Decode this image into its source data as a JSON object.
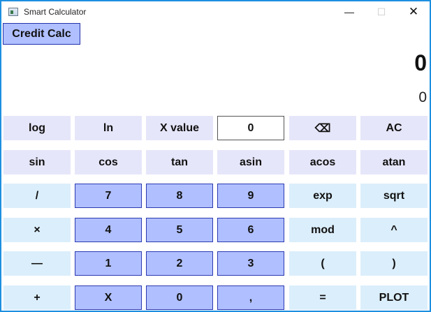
{
  "window": {
    "title": "Smart Calculator",
    "min_label": "—",
    "max_label": "☐",
    "close_label": "✕"
  },
  "credit_button": "Credit Calc",
  "display": {
    "main": "0",
    "sub": "0"
  },
  "rows": [
    [
      {
        "label": "log",
        "kind": "func"
      },
      {
        "label": "ln",
        "kind": "func"
      },
      {
        "label": "X value",
        "kind": "func"
      },
      {
        "label": "0",
        "kind": "input"
      },
      {
        "label": "⌫",
        "kind": "func"
      },
      {
        "label": "AC",
        "kind": "func"
      }
    ],
    [
      {
        "label": "sin",
        "kind": "func"
      },
      {
        "label": "cos",
        "kind": "func"
      },
      {
        "label": "tan",
        "kind": "func"
      },
      {
        "label": "asin",
        "kind": "func"
      },
      {
        "label": "acos",
        "kind": "func"
      },
      {
        "label": "atan",
        "kind": "func"
      }
    ],
    [
      {
        "label": "/",
        "kind": "op"
      },
      {
        "label": "7",
        "kind": "num"
      },
      {
        "label": "8",
        "kind": "num"
      },
      {
        "label": "9",
        "kind": "num"
      },
      {
        "label": "exp",
        "kind": "op"
      },
      {
        "label": "sqrt",
        "kind": "op"
      }
    ],
    [
      {
        "label": "×",
        "kind": "op"
      },
      {
        "label": "4",
        "kind": "num"
      },
      {
        "label": "5",
        "kind": "num"
      },
      {
        "label": "6",
        "kind": "num"
      },
      {
        "label": "mod",
        "kind": "op"
      },
      {
        "label": "^",
        "kind": "op"
      }
    ],
    [
      {
        "label": "—",
        "kind": "op"
      },
      {
        "label": "1",
        "kind": "num"
      },
      {
        "label": "2",
        "kind": "num"
      },
      {
        "label": "3",
        "kind": "num"
      },
      {
        "label": "(",
        "kind": "op"
      },
      {
        "label": ")",
        "kind": "op"
      }
    ],
    [
      {
        "label": "+",
        "kind": "op"
      },
      {
        "label": "X",
        "kind": "num"
      },
      {
        "label": "0",
        "kind": "num"
      },
      {
        "label": ",",
        "kind": "num"
      },
      {
        "label": "=",
        "kind": "op"
      },
      {
        "label": "PLOT",
        "kind": "op"
      }
    ]
  ],
  "colors": {
    "window_border": "#1c8fe0",
    "func_key": "#e6e6fa",
    "op_key": "#dbeefb",
    "num_key": "#b0bfff"
  }
}
